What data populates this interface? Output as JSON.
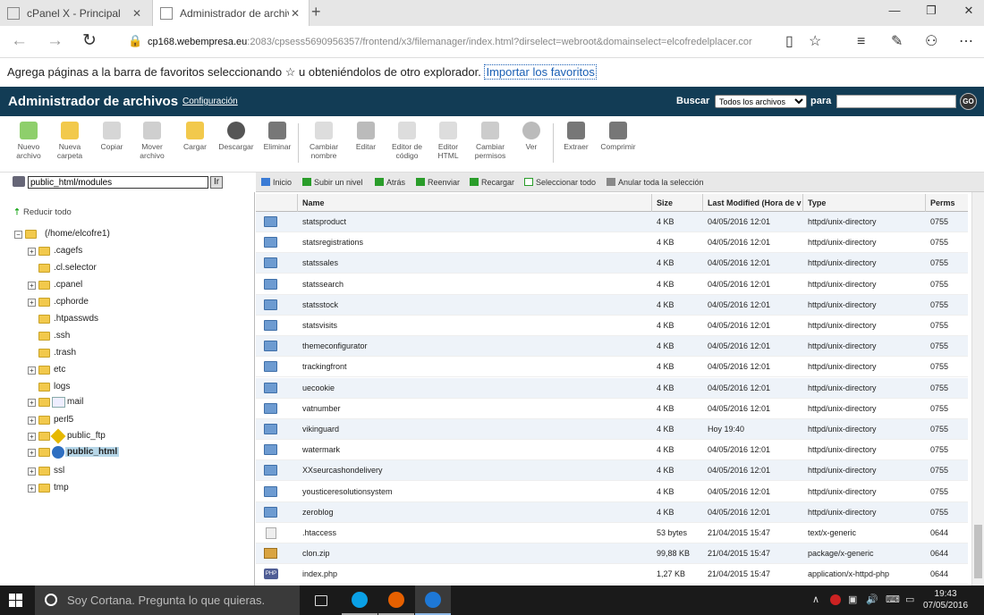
{
  "browser": {
    "tabs": [
      {
        "label": "cPanel X - Principal"
      },
      {
        "label": "Administrador de archiv"
      }
    ],
    "url": {
      "host": "cp168.webempresa.eu",
      "rest": ":2083/cpsess5690956357/frontend/x3/filemanager/index.html?dirselect=webroot&domainselect=elcofredelplacer.cor"
    },
    "favbar": {
      "text": "Agrega páginas a la barra de favoritos seleccionando ☆ u obteniéndolos de otro explorador.",
      "link": "Importar los favoritos"
    }
  },
  "header": {
    "title": "Administrador de archivos",
    "config": "Configuración",
    "search_label": "Buscar",
    "search_option": "Todos los archivos",
    "para": "para",
    "go": "GO"
  },
  "toolbar": [
    {
      "label": "Nuevo archivo",
      "icon": "new-file-icon",
      "color": "#8ecf6b"
    },
    {
      "label": "Nueva carpeta",
      "icon": "new-folder-icon",
      "color": "#f2c94c"
    },
    {
      "label": "Copiar",
      "icon": "copy-icon",
      "color": "#d6d6d6"
    },
    {
      "label": "Mover archivo",
      "icon": "move-icon",
      "color": "#cfcfcf"
    },
    {
      "label": "Cargar",
      "icon": "upload-icon",
      "color": "#f2c94c"
    },
    {
      "label": "Descargar",
      "icon": "download-icon",
      "color": "#555555"
    },
    {
      "label": "Eliminar",
      "icon": "delete-icon",
      "color": "#777777"
    },
    {
      "label": "Cambiar nombre",
      "icon": "rename-icon",
      "color": "#dddddd"
    },
    {
      "label": "Editar",
      "icon": "edit-icon",
      "color": "#bbbbbb"
    },
    {
      "label": "Editor de código",
      "icon": "code-editor-icon",
      "color": "#dddddd"
    },
    {
      "label": "Editor HTML",
      "icon": "html-editor-icon",
      "color": "#dddddd"
    },
    {
      "label": "Cambiar permisos",
      "icon": "permissions-icon",
      "color": "#cccccc"
    },
    {
      "label": "Ver",
      "icon": "view-icon",
      "color": "#bbbbbb"
    },
    {
      "label": "Extraer",
      "icon": "extract-icon",
      "color": "#777777"
    },
    {
      "label": "Comprimir",
      "icon": "compress-icon",
      "color": "#777777"
    }
  ],
  "path": {
    "value": "public_html/modules",
    "go": "Ir"
  },
  "tree": {
    "collapse": "Reducir todo",
    "root": "(/home/elcofre1)",
    "items": [
      {
        "label": ".cagefs",
        "pm": "+"
      },
      {
        "label": ".cl.selector",
        "pm": ""
      },
      {
        "label": ".cpanel",
        "pm": "+"
      },
      {
        "label": ".cphorde",
        "pm": "+"
      },
      {
        "label": ".htpasswds",
        "pm": ""
      },
      {
        "label": ".ssh",
        "pm": ""
      },
      {
        "label": ".trash",
        "pm": ""
      },
      {
        "label": "etc",
        "pm": "+"
      },
      {
        "label": "logs",
        "pm": ""
      },
      {
        "label": "mail",
        "pm": "+"
      },
      {
        "label": "perl5",
        "pm": "+"
      },
      {
        "label": "public_ftp",
        "pm": "+"
      },
      {
        "label": "public_html",
        "pm": "+"
      },
      {
        "label": "ssl",
        "pm": "+"
      },
      {
        "label": "tmp",
        "pm": "+"
      }
    ]
  },
  "actions": [
    {
      "label": "Inicio",
      "color": "#3a7bd5"
    },
    {
      "label": "Subir un nivel",
      "color": "#2a9d2a"
    },
    {
      "label": "Atrás",
      "color": "#2a9d2a"
    },
    {
      "label": "Reenviar",
      "color": "#2a9d2a"
    },
    {
      "label": "Recargar",
      "color": "#2a9d2a"
    },
    {
      "label": "Seleccionar todo",
      "color": "#2a9d2a"
    },
    {
      "label": "Anular toda la selección",
      "color": "#888888"
    }
  ],
  "columns": [
    "Name",
    "Size",
    "Last Modified (Hora de v",
    "Type",
    "Perms"
  ],
  "files": [
    {
      "name": "statsproduct",
      "size": "4 KB",
      "modified": "04/05/2016 12:01",
      "type": "httpd/unix-directory",
      "perms": "0755",
      "kind": "dir"
    },
    {
      "name": "statsregistrations",
      "size": "4 KB",
      "modified": "04/05/2016 12:01",
      "type": "httpd/unix-directory",
      "perms": "0755",
      "kind": "dir"
    },
    {
      "name": "statssales",
      "size": "4 KB",
      "modified": "04/05/2016 12:01",
      "type": "httpd/unix-directory",
      "perms": "0755",
      "kind": "dir"
    },
    {
      "name": "statssearch",
      "size": "4 KB",
      "modified": "04/05/2016 12:01",
      "type": "httpd/unix-directory",
      "perms": "0755",
      "kind": "dir"
    },
    {
      "name": "statsstock",
      "size": "4 KB",
      "modified": "04/05/2016 12:01",
      "type": "httpd/unix-directory",
      "perms": "0755",
      "kind": "dir"
    },
    {
      "name": "statsvisits",
      "size": "4 KB",
      "modified": "04/05/2016 12:01",
      "type": "httpd/unix-directory",
      "perms": "0755",
      "kind": "dir"
    },
    {
      "name": "themeconfigurator",
      "size": "4 KB",
      "modified": "04/05/2016 12:01",
      "type": "httpd/unix-directory",
      "perms": "0755",
      "kind": "dir"
    },
    {
      "name": "trackingfront",
      "size": "4 KB",
      "modified": "04/05/2016 12:01",
      "type": "httpd/unix-directory",
      "perms": "0755",
      "kind": "dir"
    },
    {
      "name": "uecookie",
      "size": "4 KB",
      "modified": "04/05/2016 12:01",
      "type": "httpd/unix-directory",
      "perms": "0755",
      "kind": "dir"
    },
    {
      "name": "vatnumber",
      "size": "4 KB",
      "modified": "04/05/2016 12:01",
      "type": "httpd/unix-directory",
      "perms": "0755",
      "kind": "dir"
    },
    {
      "name": "vikinguard",
      "size": "4 KB",
      "modified": "Hoy 19:40",
      "type": "httpd/unix-directory",
      "perms": "0755",
      "kind": "dir"
    },
    {
      "name": "watermark",
      "size": "4 KB",
      "modified": "04/05/2016 12:01",
      "type": "httpd/unix-directory",
      "perms": "0755",
      "kind": "dir"
    },
    {
      "name": "XXseurcashondelivery",
      "size": "4 KB",
      "modified": "04/05/2016 12:01",
      "type": "httpd/unix-directory",
      "perms": "0755",
      "kind": "dir"
    },
    {
      "name": "yousticeresolutionsystem",
      "size": "4 KB",
      "modified": "04/05/2016 12:01",
      "type": "httpd/unix-directory",
      "perms": "0755",
      "kind": "dir"
    },
    {
      "name": "zeroblog",
      "size": "4 KB",
      "modified": "04/05/2016 12:01",
      "type": "httpd/unix-directory",
      "perms": "0755",
      "kind": "dir"
    },
    {
      "name": ".htaccess",
      "size": "53 bytes",
      "modified": "21/04/2015 15:47",
      "type": "text/x-generic",
      "perms": "0644",
      "kind": "txt"
    },
    {
      "name": "clon.zip",
      "size": "99,88 KB",
      "modified": "21/04/2015 15:47",
      "type": "package/x-generic",
      "perms": "0644",
      "kind": "zip"
    },
    {
      "name": "index.php",
      "size": "1,27 KB",
      "modified": "21/04/2015 15:47",
      "type": "application/x-httpd-php",
      "perms": "0644",
      "kind": "php"
    }
  ],
  "taskbar": {
    "cortana": "Soy Cortana. Pregunta lo que quieras.",
    "time": "19:43",
    "date": "07/05/2016"
  }
}
